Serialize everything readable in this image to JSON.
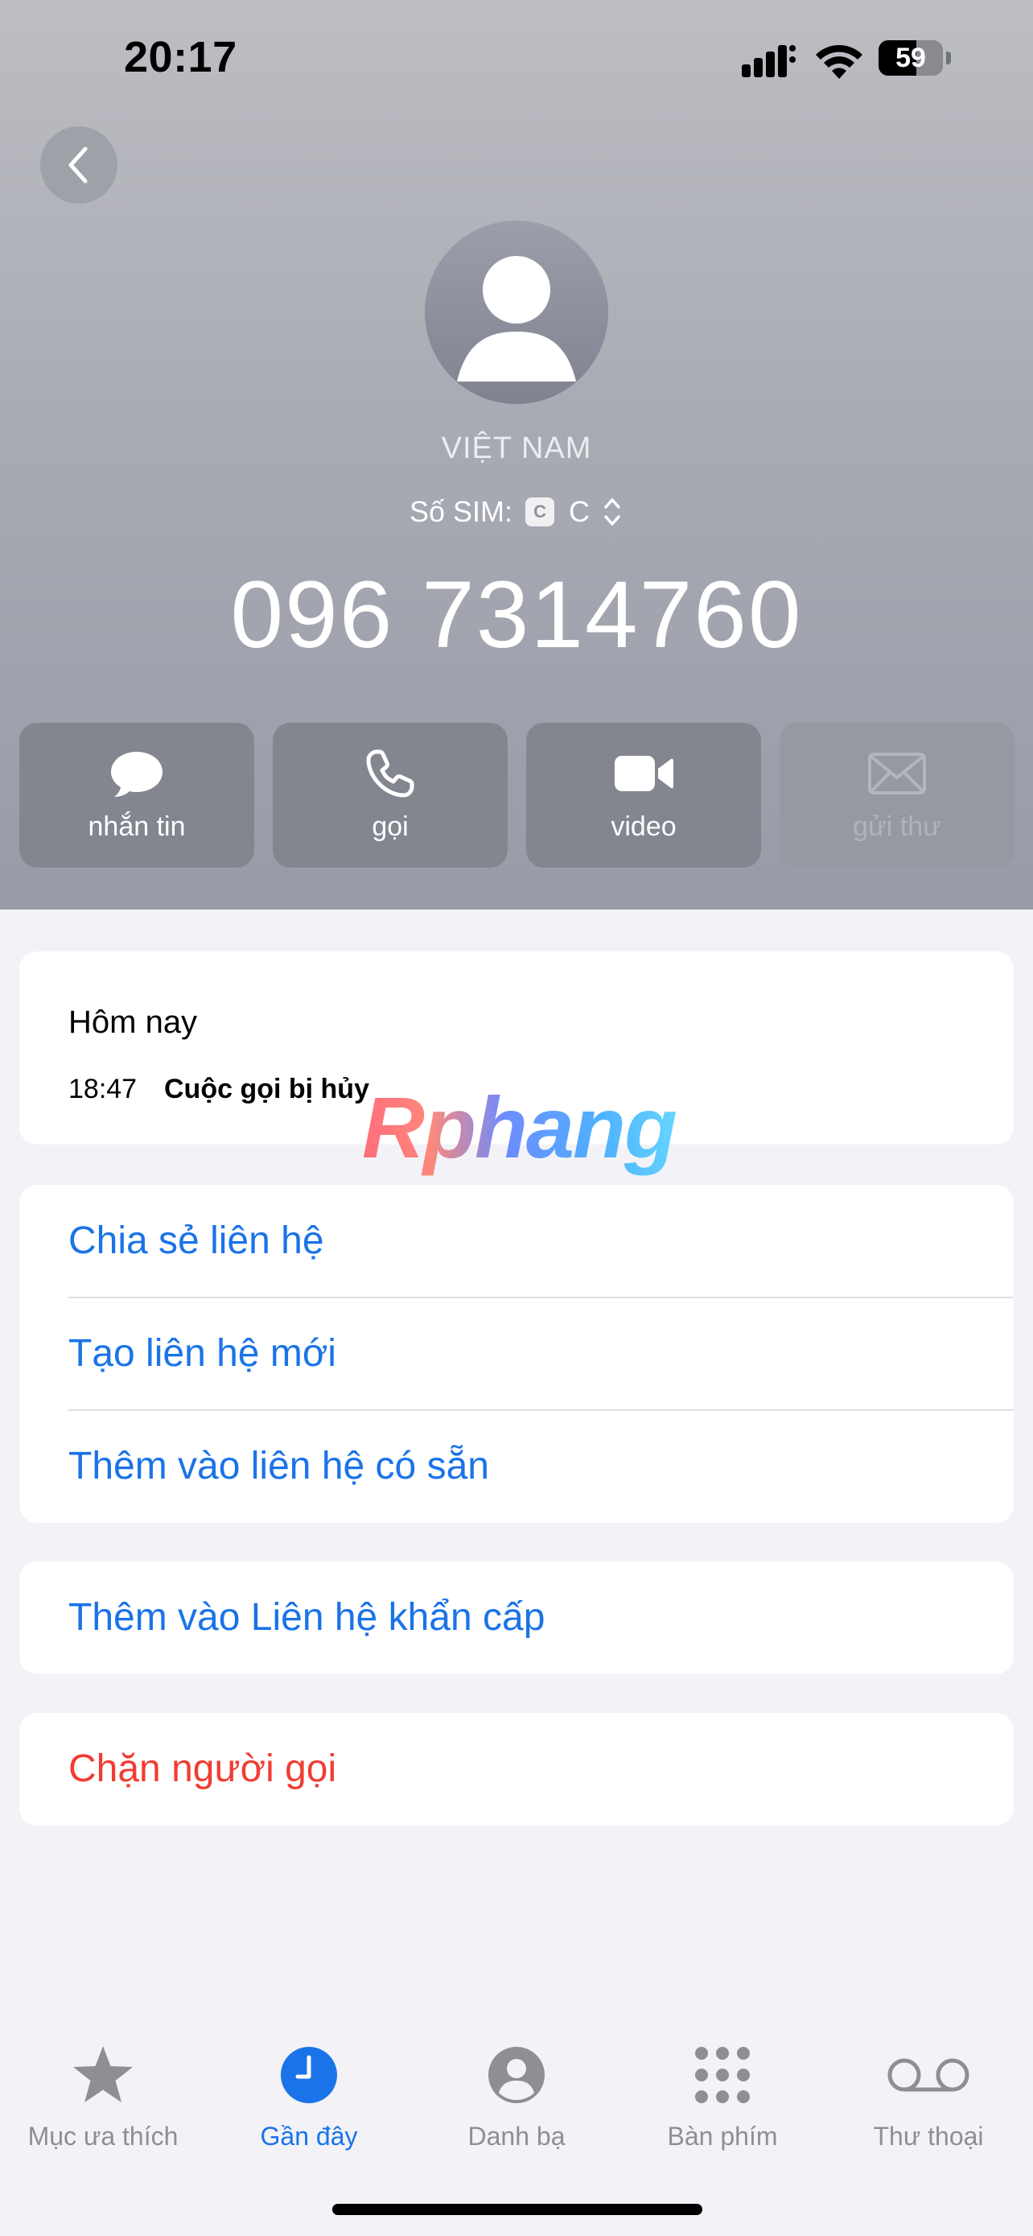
{
  "status_bar": {
    "time": "20:17",
    "battery": "59"
  },
  "contact": {
    "country": "VIỆT NAM",
    "sim_label": "Số SIM:",
    "sim_badge": "C",
    "sim_value": "C",
    "phone_number": "096 7314760"
  },
  "actions": [
    {
      "label": "nhắn tin",
      "icon": "message-bubble-icon",
      "enabled": true
    },
    {
      "label": "gọi",
      "icon": "phone-icon",
      "enabled": true
    },
    {
      "label": "video",
      "icon": "video-camera-icon",
      "enabled": true
    },
    {
      "label": "gửi thư",
      "icon": "envelope-icon",
      "enabled": false
    }
  ],
  "history": {
    "date": "Hôm nay",
    "time": "18:47",
    "status": "Cuộc gọi bị hủy"
  },
  "watermark": "Rphang",
  "options": [
    "Chia sẻ liên hệ",
    "Tạo liên hệ mới",
    "Thêm vào liên hệ có sẵn"
  ],
  "emergency": "Thêm vào Liên hệ khẩn cấp",
  "block": "Chặn người gọi",
  "tabs": [
    {
      "label": "Mục ưa thích",
      "icon": "star-icon",
      "active": false
    },
    {
      "label": "Gần đây",
      "icon": "clock-icon",
      "active": true
    },
    {
      "label": "Danh bạ",
      "icon": "person-circle-icon",
      "active": false
    },
    {
      "label": "Bàn phím",
      "icon": "keypad-icon",
      "active": false
    },
    {
      "label": "Thư thoại",
      "icon": "voicemail-icon",
      "active": false
    }
  ],
  "colors": {
    "accent_blue": "#1a73e8",
    "destructive_red": "#f23c32",
    "header_gray": "#a9abb4"
  }
}
